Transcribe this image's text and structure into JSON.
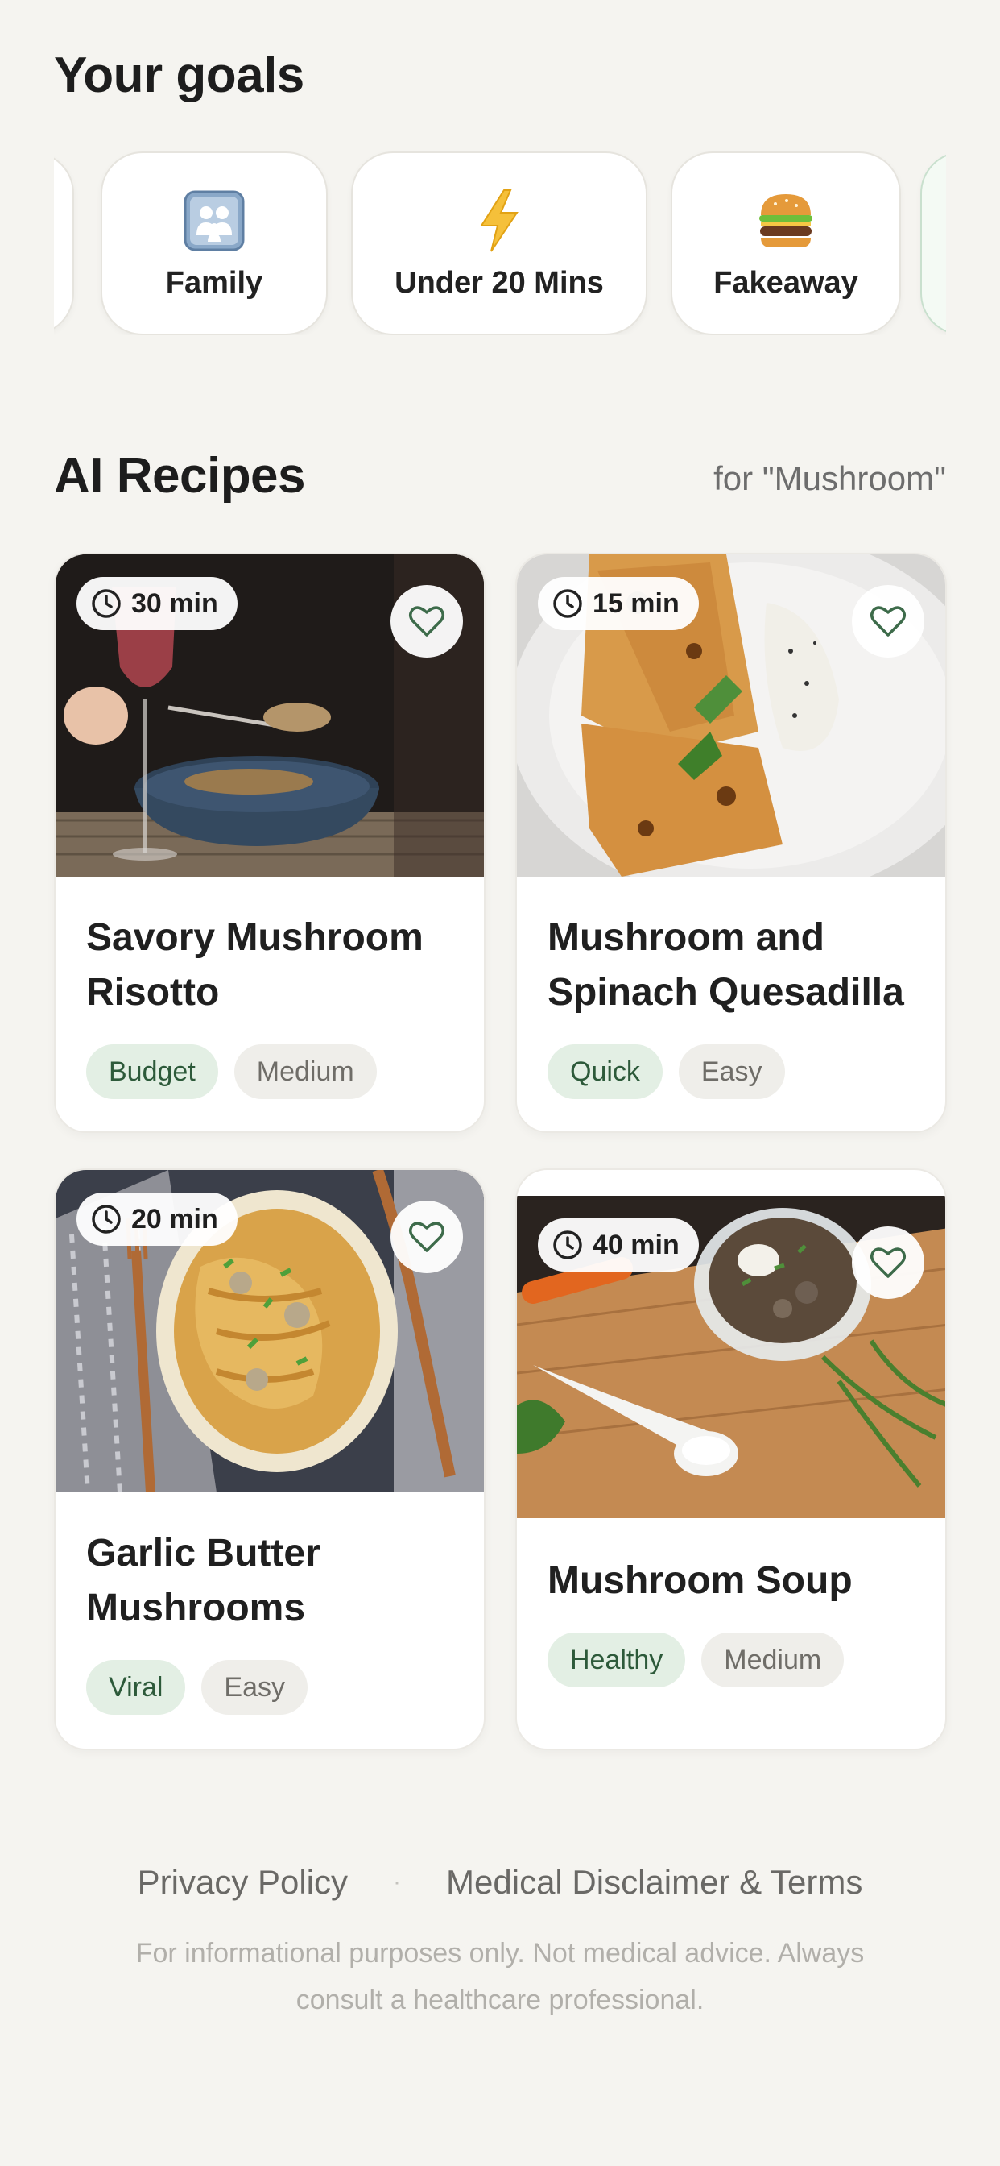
{
  "goals": {
    "title": "Your goals",
    "items": [
      {
        "label": "Family",
        "icon": "family-icon"
      },
      {
        "label": "Under 20 Mins",
        "icon": "lightning-icon"
      },
      {
        "label": "Fakeaway",
        "icon": "burger-icon"
      }
    ]
  },
  "recipes": {
    "title": "AI Recipes",
    "subtitle": "for \"Mushroom\"",
    "cards": [
      {
        "time": "30 min",
        "title": "Savory Mushroom Risotto",
        "tags": [
          "Budget",
          "Medium"
        ]
      },
      {
        "time": "15 min",
        "title": "Mushroom and Spinach Quesadilla",
        "tags": [
          "Quick",
          "Easy"
        ]
      },
      {
        "time": "20 min",
        "title": "Garlic Butter Mushrooms",
        "tags": [
          "Viral",
          "Easy"
        ]
      },
      {
        "time": "40 min",
        "title": "Mushroom Soup",
        "tags": [
          "Healthy",
          "Medium"
        ]
      }
    ]
  },
  "footer": {
    "privacy": "Privacy Policy",
    "separator": "·",
    "terms": "Medical Disclaimer & Terms",
    "note": "For informational purposes only. Not medical advice. Always consult a healthcare professional."
  },
  "colors": {
    "background": "#f5f4f0",
    "accent_green": "#2d5a3a",
    "tag_green_bg": "#e3efe4",
    "tag_grey_bg": "#efeeea"
  }
}
